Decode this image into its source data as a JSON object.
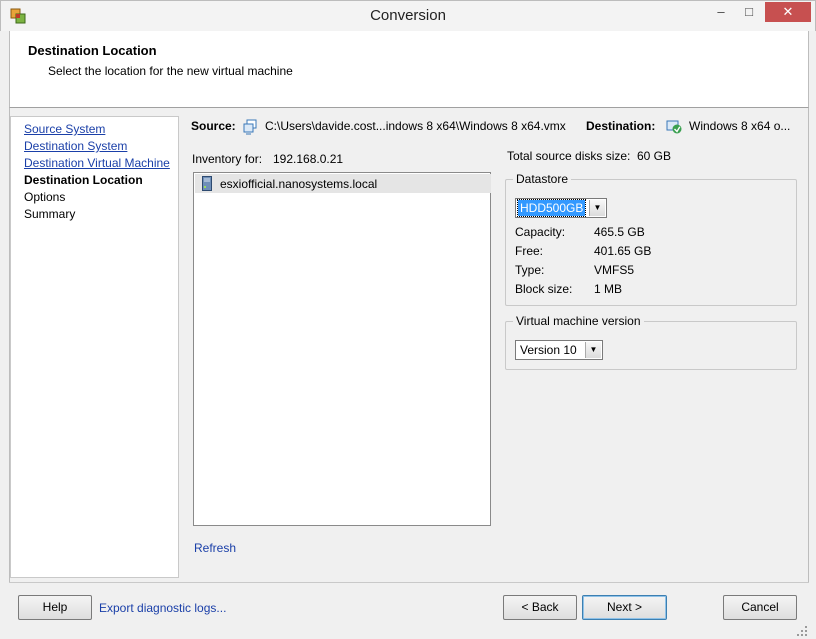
{
  "window": {
    "title": "Conversion",
    "minimize_glyph": "–",
    "maximize_glyph": "□",
    "close_glyph": "✕"
  },
  "header": {
    "title": "Destination Location",
    "subtitle": "Select the location for the new virtual machine"
  },
  "nav": {
    "items": [
      {
        "label": "Source System",
        "state": "link"
      },
      {
        "label": "Destination System",
        "state": "link"
      },
      {
        "label": "Destination Virtual Machine",
        "state": "link"
      },
      {
        "label": "Destination Location",
        "state": "current"
      },
      {
        "label": "Options",
        "state": "pending"
      },
      {
        "label": "Summary",
        "state": "pending"
      }
    ]
  },
  "source": {
    "label": "Source:",
    "path": "C:\\Users\\davide.cost...indows 8 x64\\Windows 8 x64.vmx",
    "icon": "source-vm-icon"
  },
  "destination": {
    "label": "Destination:",
    "name": "Windows 8 x64 o...",
    "icon": "destination-vm-icon"
  },
  "inventory": {
    "label": "Inventory for:",
    "host": "192.168.0.21",
    "items": [
      {
        "label": "esxiofficial.nanosystems.local",
        "icon": "host-icon"
      }
    ]
  },
  "refresh_label": "Refresh",
  "disks": {
    "label": "Total source disks size:",
    "value": "60 GB"
  },
  "datastore": {
    "group_label": "Datastore",
    "selected": "HDD500GB",
    "props": [
      {
        "label": "Capacity:",
        "value": "465.5 GB"
      },
      {
        "label": "Free:",
        "value": "401.65 GB"
      },
      {
        "label": "Type:",
        "value": "VMFS5"
      },
      {
        "label": "Block size:",
        "value": "1 MB"
      }
    ]
  },
  "vm_version": {
    "group_label": "Virtual machine version",
    "selected": "Version 10"
  },
  "dropdown_glyph": "▼",
  "buttons": {
    "help": "Help",
    "export_logs": "Export diagnostic logs...",
    "back": "< Back",
    "next": "Next >",
    "cancel": "Cancel"
  },
  "colors": {
    "link": "#1a3fa8",
    "selection": "#3399ff",
    "close_button": "#c75050"
  }
}
